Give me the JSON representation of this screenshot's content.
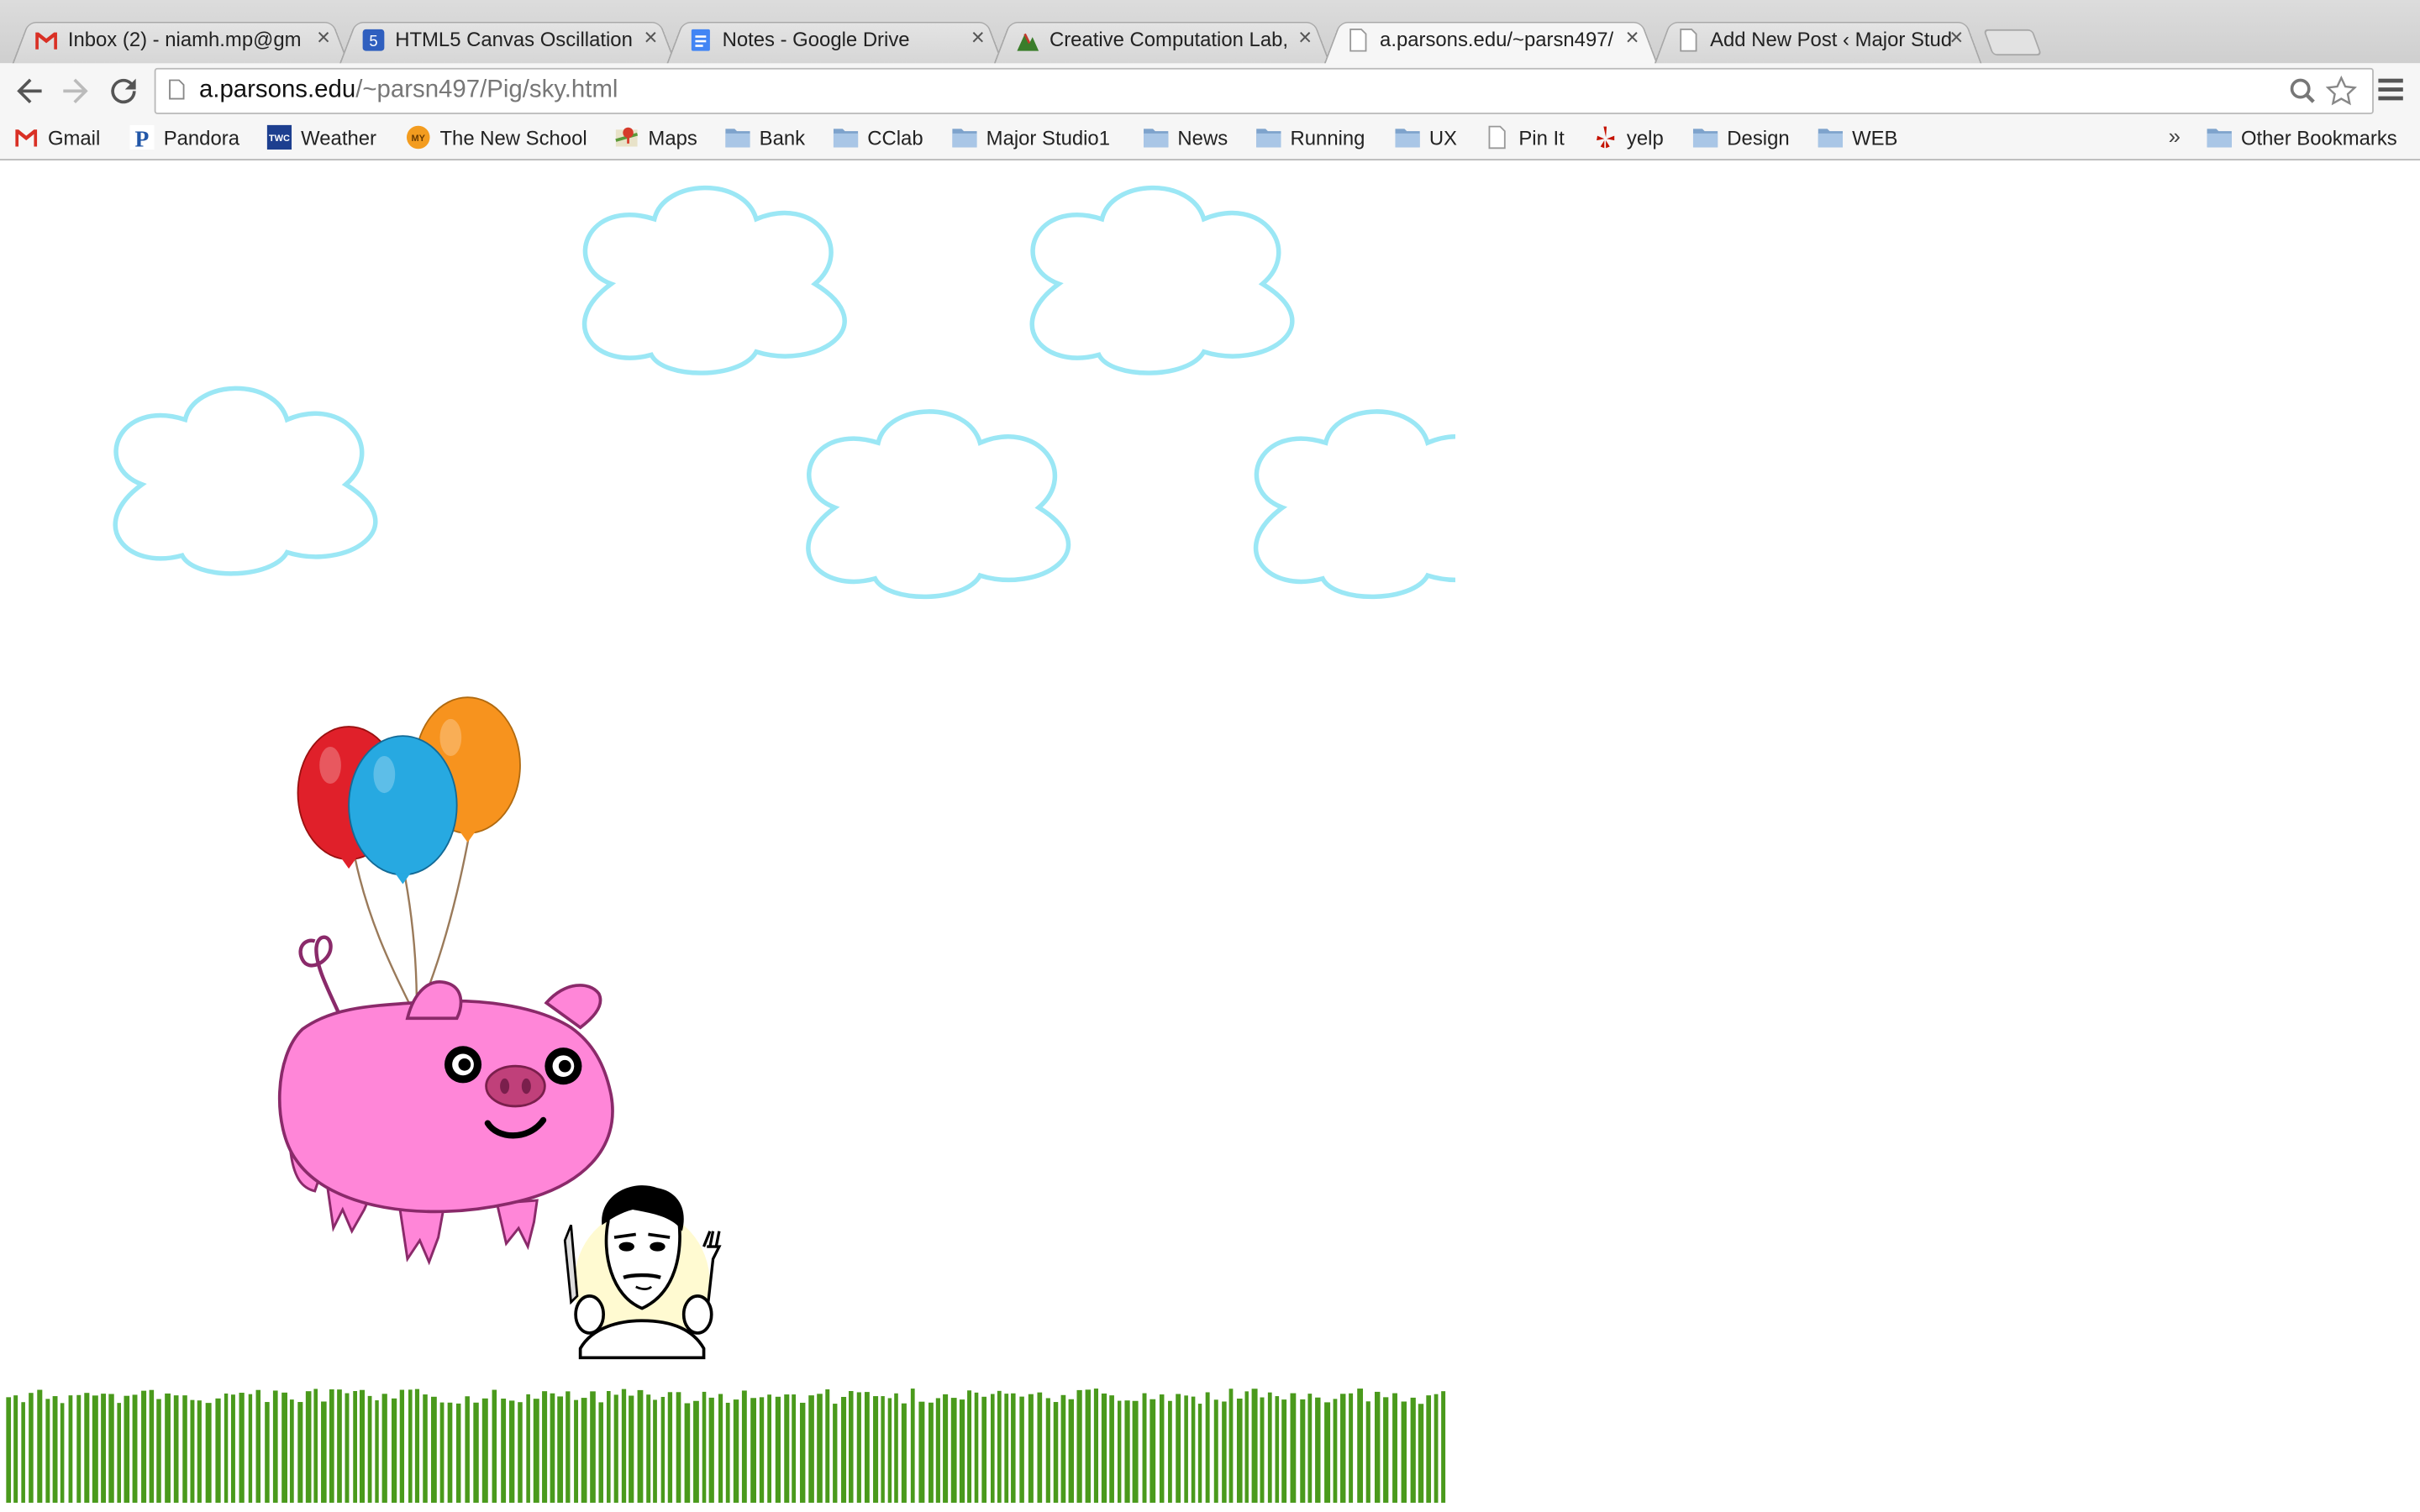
{
  "browser": {
    "tabs": [
      {
        "title": "Inbox (2) - niamh.mp@gm",
        "favicon": "gmail-icon",
        "active": false
      },
      {
        "title": "HTML5 Canvas Oscillation",
        "favicon": "html5-icon",
        "active": false
      },
      {
        "title": "Notes - Google Drive",
        "favicon": "google-docs-icon",
        "active": false
      },
      {
        "title": "Creative Computation Lab,",
        "favicon": "site-icon",
        "active": false
      },
      {
        "title": "a.parsons.edu/~parsn497/",
        "favicon": "page-icon",
        "active": true
      },
      {
        "title": "Add New Post ‹ Major Stud",
        "favicon": "page-icon",
        "active": false
      }
    ],
    "close_glyph": "×",
    "url": {
      "host": "a.parsons.edu",
      "path": "/~parsn497/Pig/sky.html"
    },
    "bookmarks": [
      {
        "label": "Gmail",
        "icon": "gmail-icon"
      },
      {
        "label": "Pandora",
        "icon": "pandora-icon"
      },
      {
        "label": "Weather",
        "icon": "twc-icon"
      },
      {
        "label": "The New School",
        "icon": "newschool-icon"
      },
      {
        "label": "Maps",
        "icon": "maps-icon"
      },
      {
        "label": "Bank",
        "icon": "folder-icon"
      },
      {
        "label": "CClab",
        "icon": "folder-icon"
      },
      {
        "label": "Major Studio1",
        "icon": "folder-icon"
      },
      {
        "label": "News",
        "icon": "folder-icon"
      },
      {
        "label": "Running",
        "icon": "folder-icon"
      },
      {
        "label": "UX",
        "icon": "folder-icon"
      },
      {
        "label": "Pin It",
        "icon": "page-icon"
      },
      {
        "label": "yelp",
        "icon": "yelp-icon"
      },
      {
        "label": "Design",
        "icon": "folder-icon"
      },
      {
        "label": "WEB",
        "icon": "folder-icon"
      }
    ],
    "overflow_glyph": "»",
    "other_bookmarks": "Other Bookmarks",
    "favicon_text": {
      "html5": "5",
      "twc": "TWC",
      "newschool": "MY",
      "pandora": "P"
    }
  },
  "scene": {
    "cloud_color": "#9be7f5",
    "grass_color": "#4a9a1c",
    "pig_color": "#ff86d8",
    "pig_outline": "#8a2a6a",
    "balloons": [
      {
        "color": "#e0202a",
        "name": "red"
      },
      {
        "color": "#f7931e",
        "name": "orange"
      },
      {
        "color": "#27a9e1",
        "name": "blue"
      }
    ]
  }
}
